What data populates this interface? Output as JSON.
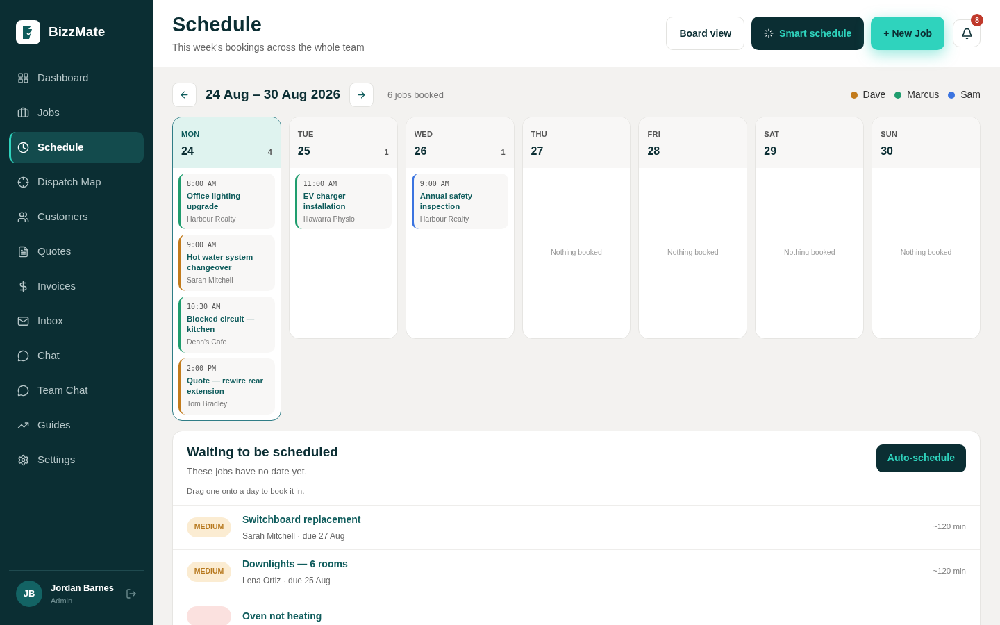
{
  "sidebar": {
    "brand": "BizzMate",
    "items": [
      {
        "label": "Dashboard",
        "selected": false
      },
      {
        "label": "Jobs",
        "selected": false
      },
      {
        "label": "Schedule",
        "selected": true
      },
      {
        "label": "Dispatch Map",
        "selected": false
      },
      {
        "label": "Customers",
        "selected": false
      },
      {
        "label": "Quotes",
        "selected": false
      },
      {
        "label": "Invoices",
        "selected": false
      },
      {
        "label": "Inbox",
        "selected": false
      },
      {
        "label": "Chat",
        "selected": false
      },
      {
        "label": "Team Chat",
        "selected": false
      },
      {
        "label": "Guides",
        "selected": false
      },
      {
        "label": "Settings",
        "selected": false
      }
    ],
    "user": {
      "initials": "JB",
      "name": "Jordan Barnes",
      "role": "Admin"
    }
  },
  "header": {
    "title": "Schedule",
    "subtitle": "This week's bookings across the whole team",
    "buttons": [
      {
        "label": "Board view",
        "kind": "outline"
      },
      {
        "label": "Smart schedule",
        "kind": "dark"
      },
      {
        "label": "+ New Job",
        "kind": "accent"
      }
    ],
    "notifications": "8"
  },
  "week": {
    "range": "24 Aug – 30 Aug 2026",
    "summary": "6 jobs booked",
    "legend": [
      {
        "name": "Dave",
        "color": "#c27b1c"
      },
      {
        "name": "Marcus",
        "color": "#1f9d6e"
      },
      {
        "name": "Sam",
        "color": "#3b74e0"
      }
    ],
    "days": [
      {
        "weekday": "MON",
        "date": "24",
        "count": "4",
        "selected": true,
        "jobs": [
          {
            "time": "8:00 AM",
            "title": "Office lighting upgrade",
            "client": "Harbour Realty",
            "color": "#1f9d6e"
          },
          {
            "time": "9:00 AM",
            "title": "Hot water system changeover",
            "client": "Sarah Mitchell",
            "color": "#c27b1c"
          },
          {
            "time": "10:30 AM",
            "title": "Blocked circuit — kitchen",
            "client": "Dean's Cafe",
            "color": "#1f9d6e"
          },
          {
            "time": "2:00 PM",
            "title": "Quote — rewire rear extension",
            "client": "Tom Bradley",
            "color": "#c27b1c"
          }
        ]
      },
      {
        "weekday": "TUE",
        "date": "25",
        "count": "1",
        "selected": false,
        "jobs": [
          {
            "time": "11:00 AM",
            "title": "EV charger installation",
            "client": "Illawarra Physio",
            "color": "#1f9d6e"
          }
        ]
      },
      {
        "weekday": "WED",
        "date": "26",
        "count": "1",
        "selected": false,
        "jobs": [
          {
            "time": "9:00 AM",
            "title": "Annual safety inspection",
            "client": "Harbour Realty",
            "color": "#3b74e0"
          }
        ]
      },
      {
        "weekday": "THU",
        "date": "27",
        "selected": false,
        "empty": "Nothing booked"
      },
      {
        "weekday": "FRI",
        "date": "28",
        "selected": false,
        "empty": "Nothing booked"
      },
      {
        "weekday": "SAT",
        "date": "29",
        "selected": false,
        "empty": "Nothing booked"
      },
      {
        "weekday": "SUN",
        "date": "30",
        "selected": false,
        "empty": "Nothing booked"
      }
    ]
  },
  "waiting": {
    "title": "Waiting to be scheduled",
    "subtitle": "These jobs have no date yet.",
    "hint": "Drag one onto a day to book it in.",
    "button": "Auto-schedule",
    "items": [
      {
        "priority": "MEDIUM",
        "kind": "medium",
        "title": "Switchboard replacement",
        "meta": "Sarah Mitchell · due 27 Aug",
        "duration": "~120 min"
      },
      {
        "priority": "MEDIUM",
        "kind": "medium",
        "title": "Downlights — 6 rooms",
        "meta": "Lena Ortiz · due 25 Aug",
        "duration": "~120 min"
      },
      {
        "kind": "high",
        "title": "Oven not heating"
      }
    ]
  }
}
